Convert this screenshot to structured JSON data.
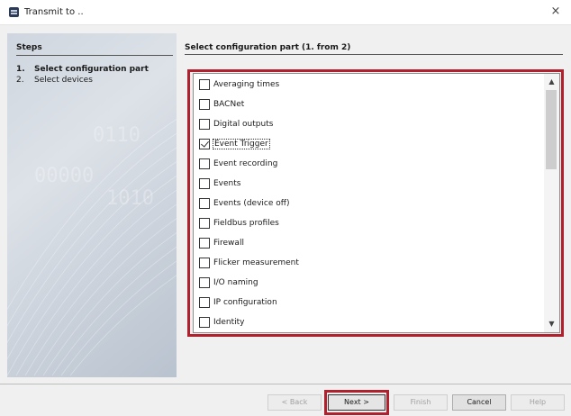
{
  "window": {
    "title": "Transmit to ..",
    "close_glyph": "×"
  },
  "steps": {
    "heading": "Steps",
    "items": [
      {
        "num": "1.",
        "label": "Select configuration part"
      },
      {
        "num": "2.",
        "label": "Select devices"
      }
    ]
  },
  "page": {
    "heading": "Select configuration part (1. from 2)"
  },
  "config_list": {
    "items": [
      {
        "label": "Averaging times",
        "checked": false
      },
      {
        "label": "BACNet",
        "checked": false
      },
      {
        "label": "Digital outputs",
        "checked": false
      },
      {
        "label": "Event Trigger",
        "checked": true
      },
      {
        "label": "Event recording",
        "checked": false
      },
      {
        "label": "Events",
        "checked": false
      },
      {
        "label": "Events (device off)",
        "checked": false
      },
      {
        "label": "Fieldbus profiles",
        "checked": false
      },
      {
        "label": "Firewall",
        "checked": false
      },
      {
        "label": "Flicker measurement",
        "checked": false
      },
      {
        "label": "I/O naming",
        "checked": false
      },
      {
        "label": "IP configuration",
        "checked": false
      },
      {
        "label": "Identity",
        "checked": false
      }
    ]
  },
  "buttons": {
    "back": "< Back",
    "next": "Next >",
    "finish": "Finish",
    "cancel": "Cancel",
    "help": "Help"
  },
  "colors": {
    "highlight": "#b0202d"
  },
  "icons": {
    "app": "app-icon",
    "close": "close-icon",
    "scroll_up": "chevron-up-icon",
    "scroll_down": "chevron-down-icon"
  }
}
